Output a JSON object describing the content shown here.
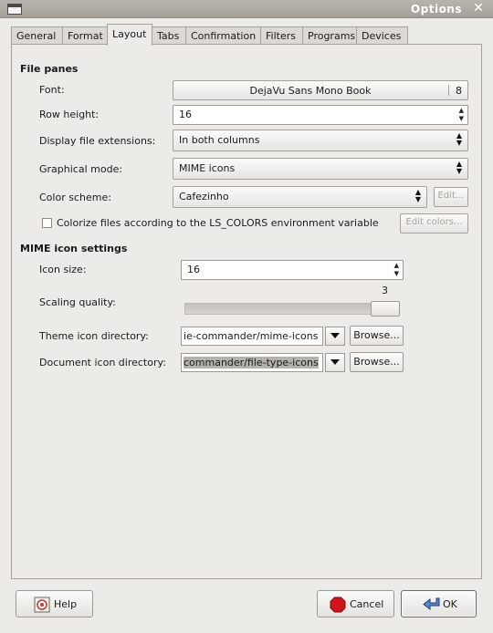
{
  "window": {
    "title": "Options",
    "close_glyph": "✕"
  },
  "tabs": [
    {
      "label": "General"
    },
    {
      "label": "Format"
    },
    {
      "label": "Layout",
      "active": true
    },
    {
      "label": "Tabs"
    },
    {
      "label": "Confirmation"
    },
    {
      "label": "Filters"
    },
    {
      "label": "Programs"
    },
    {
      "label": "Devices"
    }
  ],
  "file_panes": {
    "heading": "File panes",
    "font_label": "Font:",
    "font_name": "DejaVu Sans Mono Book",
    "font_size": "8",
    "row_height_label": "Row height:",
    "row_height_value": "16",
    "extensions_label": "Display file extensions:",
    "extensions_value": "In both columns",
    "graphical_label": "Graphical mode:",
    "graphical_value": "MIME icons",
    "color_scheme_label": "Color scheme:",
    "color_scheme_value": "Cafezinho",
    "edit_button": "Edit...",
    "colorize_label": "Colorize files according to the LS_COLORS environment variable",
    "colorize_checked": false,
    "edit_colors_button": "Edit colors..."
  },
  "mime": {
    "heading": "MIME icon settings",
    "icon_size_label": "Icon size:",
    "icon_size_value": "16",
    "scaling_label": "Scaling quality:",
    "scaling_value": "3",
    "theme_dir_label": "Theme icon directory:",
    "theme_dir_value": "ie-commander/mime-icons",
    "document_dir_label": "Document icon directory:",
    "document_dir_value": "commander/file-type-icons",
    "browse_button": "Browse..."
  },
  "buttons": {
    "help": "Help",
    "cancel": "Cancel",
    "ok": "OK"
  }
}
